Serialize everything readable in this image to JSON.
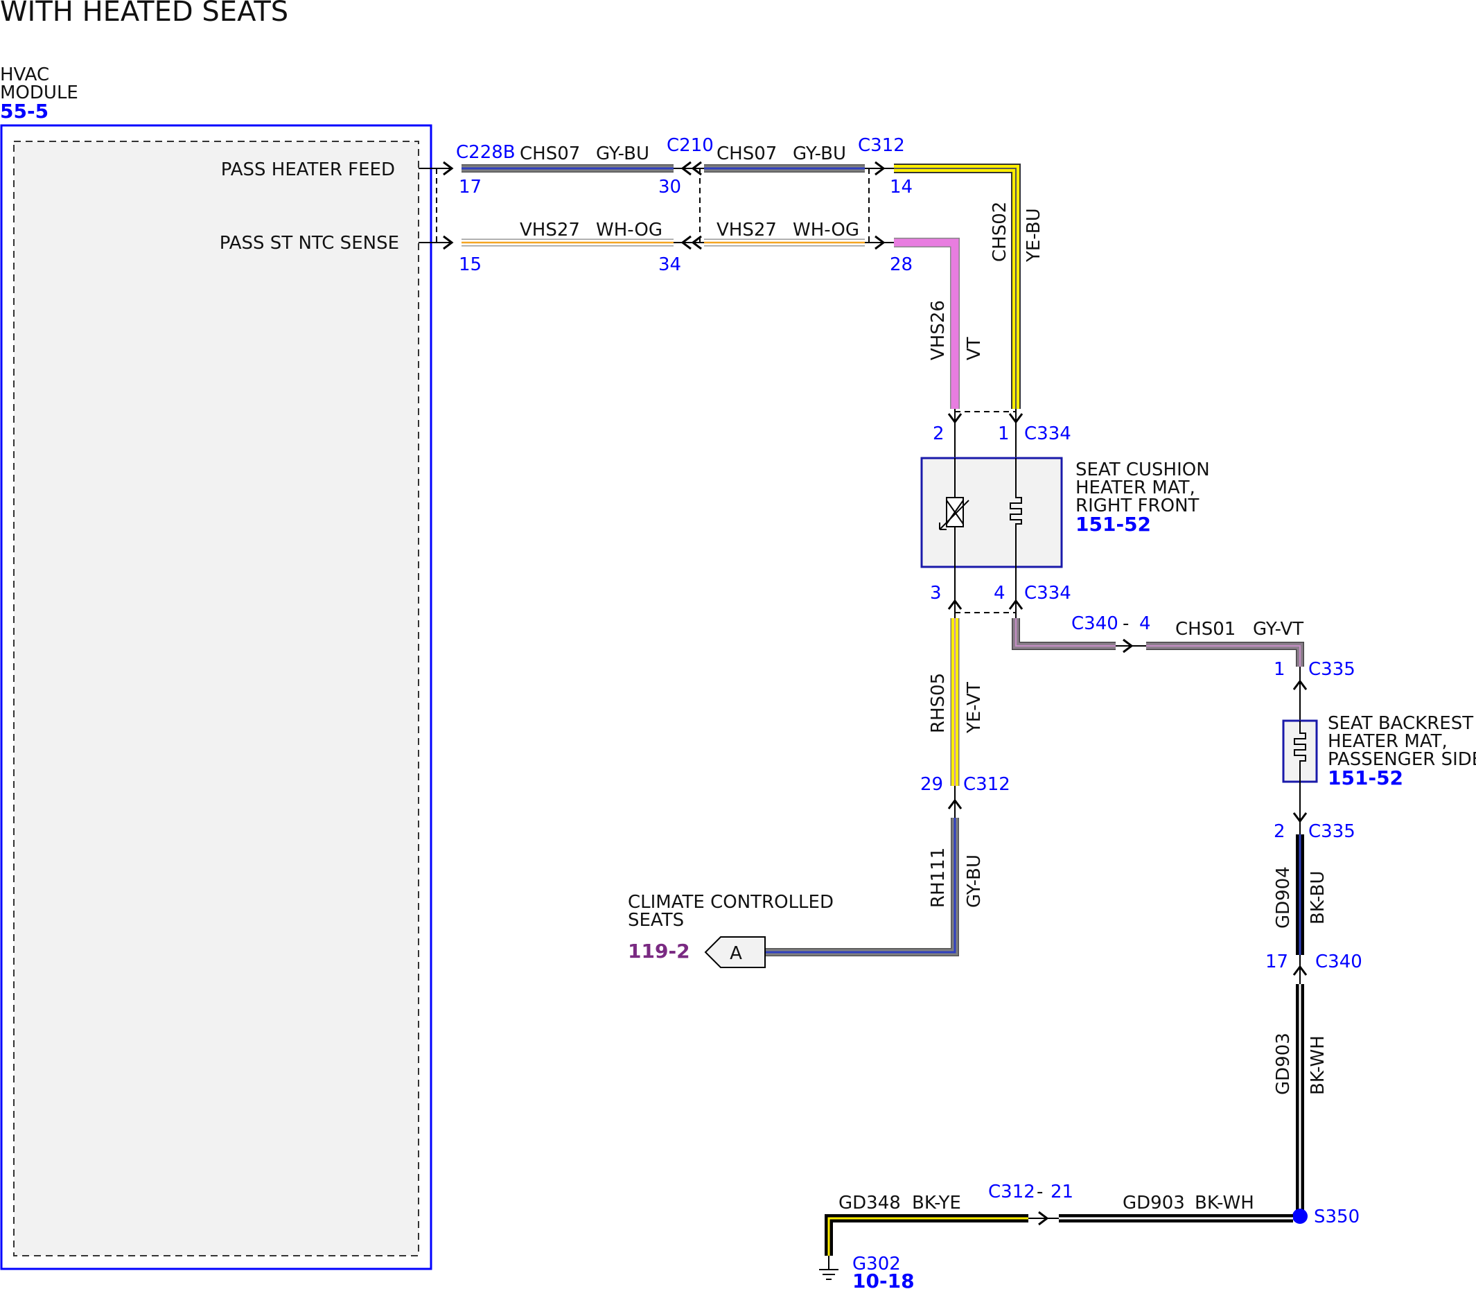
{
  "title": "WITH HEATED SEATS",
  "colors": {
    "module_border": "#0000ff",
    "module_fill": "#f2f2f2",
    "pin_text": "#0000ff",
    "ref_text": "#0000ff",
    "page_ref_text": "#7a2a82",
    "GY": "#7f7f7f",
    "BU": "#2f3fbf",
    "WH": "#ffffff",
    "OG": "#f5a623",
    "YE": "#ffee00",
    "VT": "#e87de0",
    "BK": "#000000"
  },
  "hvac_module": {
    "name_line1": "HVAC",
    "name_line2": "MODULE",
    "ref": "55-5",
    "pins": [
      {
        "label": "PASS HEATER FEED"
      },
      {
        "label": "PASS ST NTC SENSE"
      }
    ]
  },
  "connectors": {
    "c228b": {
      "name": "C228B",
      "pins": [
        "17",
        "15"
      ]
    },
    "c210": {
      "name": "C210",
      "pins": [
        "30",
        "34"
      ]
    },
    "c312_top": {
      "name": "C312",
      "pins": [
        "14",
        "28"
      ]
    },
    "c334_top": {
      "name": "C334",
      "pins": [
        "2",
        "1"
      ]
    },
    "c334_bottom": {
      "name": "C334",
      "pins": [
        "3",
        "4"
      ]
    },
    "c340_inline": {
      "name": "C340",
      "sep": "-",
      "pin": "4"
    },
    "c335_top": {
      "name": "C335",
      "pin": "1"
    },
    "c335_bottom": {
      "name": "C335",
      "pin": "2"
    },
    "c312_29": {
      "name": "C312",
      "pin": "29"
    },
    "c340_17": {
      "name": "C340",
      "pin": "17"
    },
    "c312_21": {
      "name": "C312",
      "sep": "-",
      "pin": "21"
    }
  },
  "wires": {
    "chs07_a": {
      "circuit": "CHS07",
      "color": "GY-BU"
    },
    "chs07_b": {
      "circuit": "CHS07",
      "color": "GY-BU"
    },
    "vhs27_a": {
      "circuit": "VHS27",
      "color": "WH-OG"
    },
    "vhs27_b": {
      "circuit": "VHS27",
      "color": "WH-OG"
    },
    "chs02": {
      "circuit": "CHS02",
      "color": "YE-BU"
    },
    "vhs26": {
      "circuit": "VHS26",
      "color": "VT"
    },
    "rhs05": {
      "circuit": "RHS05",
      "color": "YE-VT"
    },
    "rh111": {
      "circuit": "RH111",
      "color": "GY-BU"
    },
    "chs01": {
      "circuit": "CHS01",
      "color": "GY-VT"
    },
    "gd904": {
      "circuit": "GD904",
      "color": "BK-BU"
    },
    "gd903_v": {
      "circuit": "GD903",
      "color": "BK-WH"
    },
    "gd903_h": {
      "circuit": "GD903",
      "color": "BK-WH"
    },
    "gd348": {
      "circuit": "GD348",
      "color": "BK-YE"
    }
  },
  "seat_cushion": {
    "line1": "SEAT CUSHION",
    "line2": "HEATER MAT,",
    "line3": "RIGHT FRONT",
    "ref": "151-52"
  },
  "seat_backrest": {
    "line1": "SEAT BACKREST",
    "line2": "HEATER MAT,",
    "line3": "PASSENGER SIDE",
    "ref": "151-52"
  },
  "climate_seats": {
    "line1": "CLIMATE CONTROLLED",
    "line2": "SEATS",
    "ref": "119-2",
    "connector_letter": "A"
  },
  "splice": {
    "name": "S350"
  },
  "ground": {
    "name": "G302",
    "ref": "10-18"
  }
}
